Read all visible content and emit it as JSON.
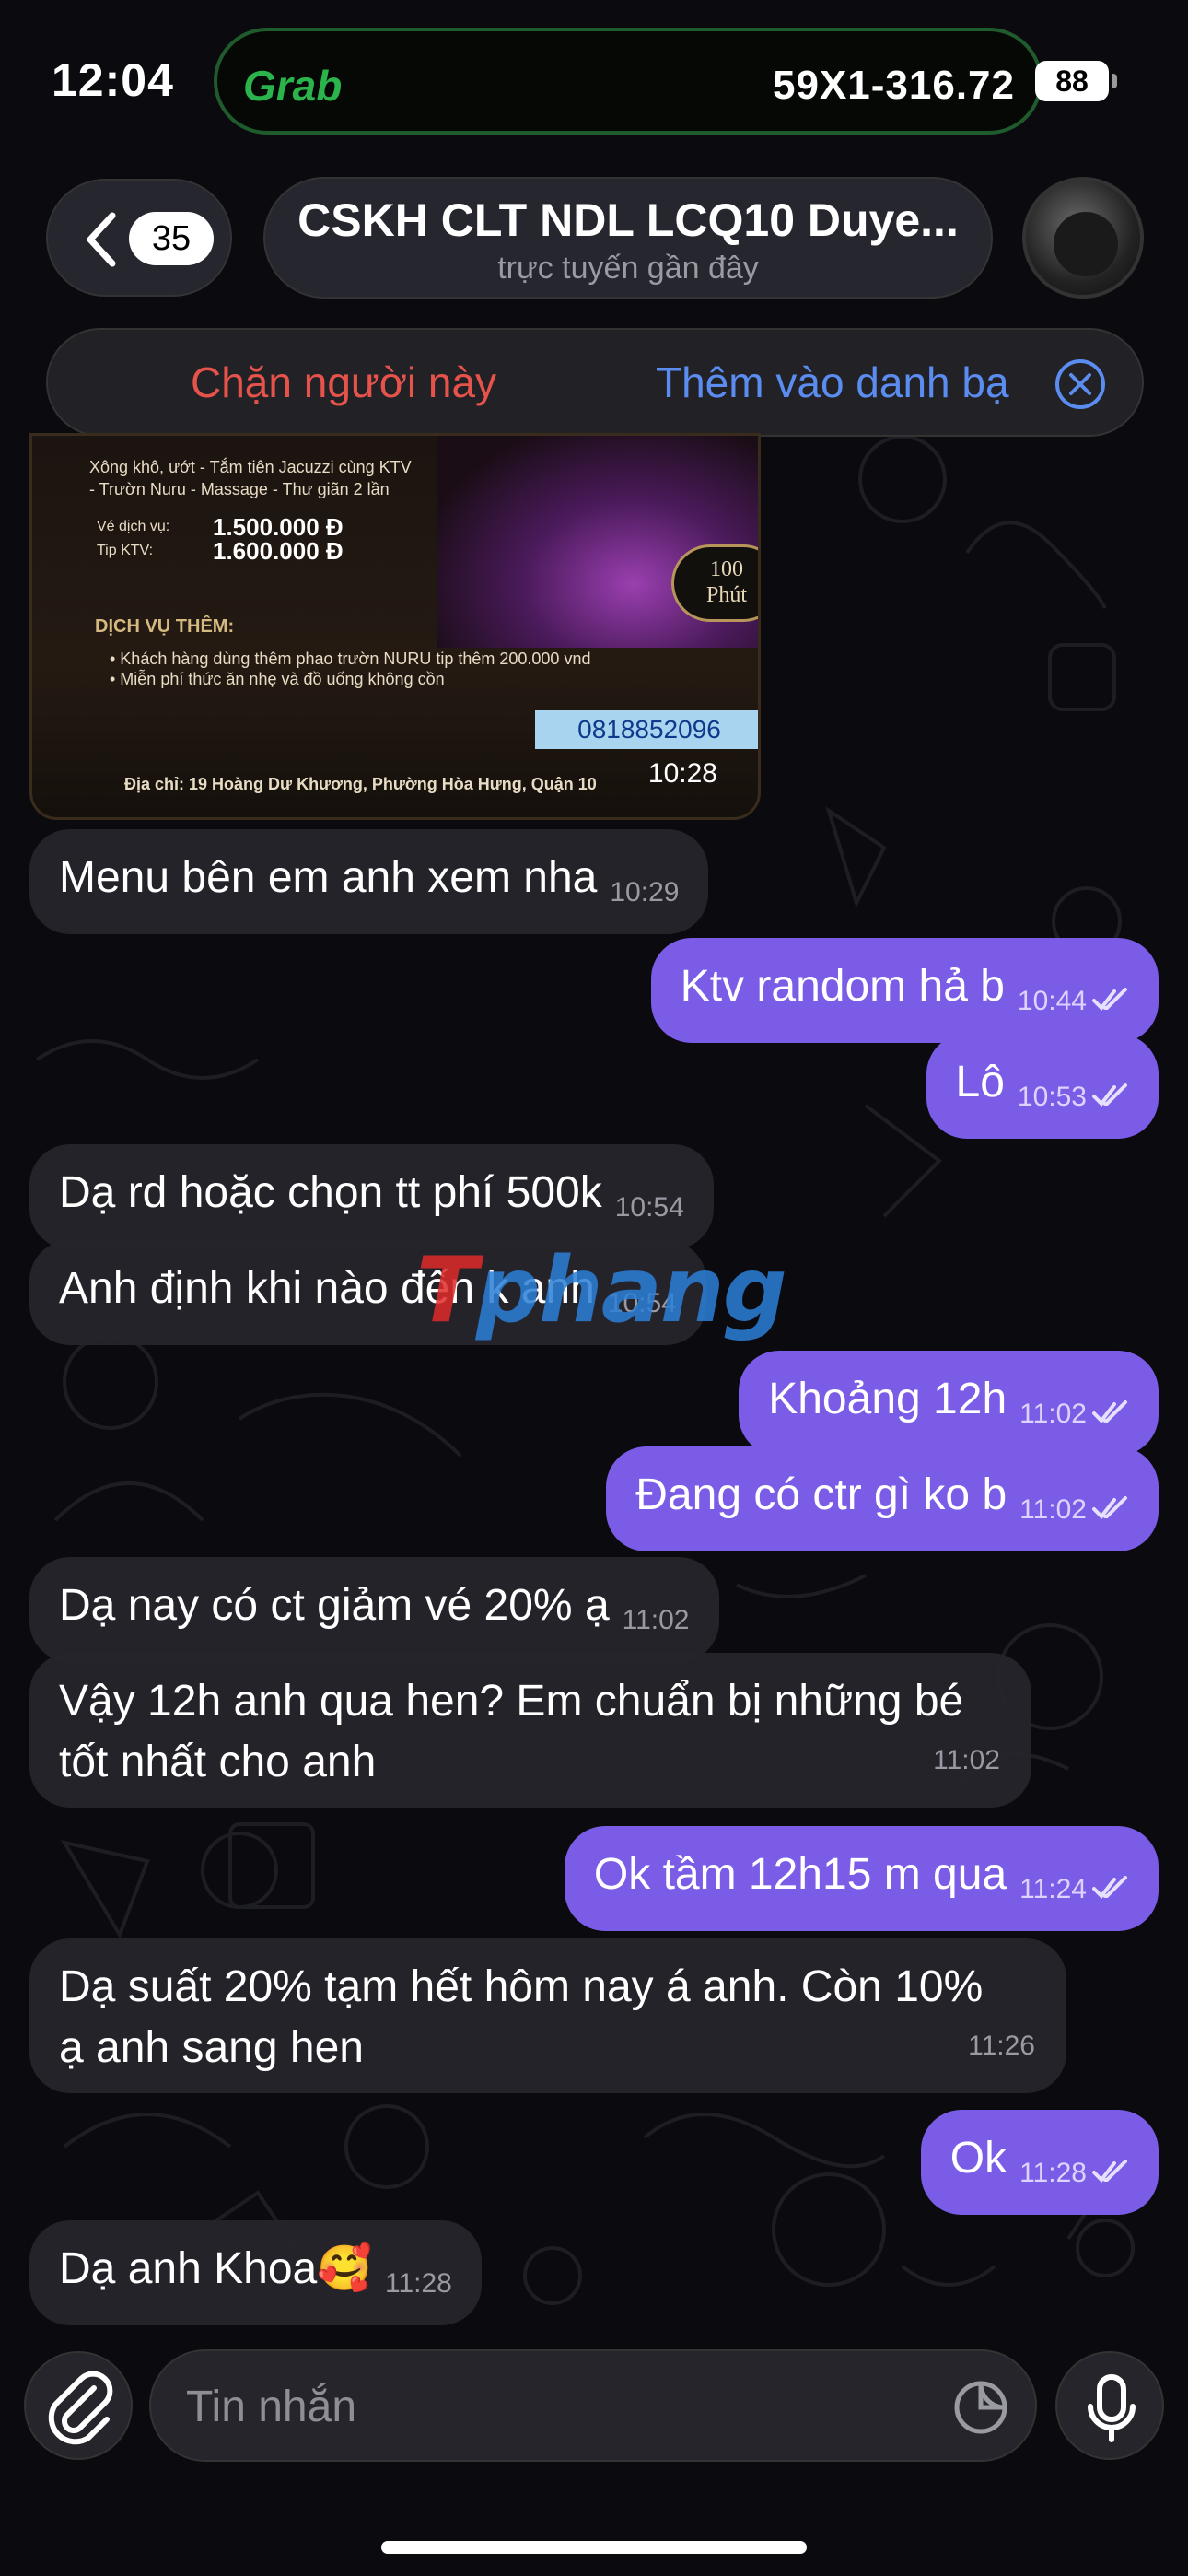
{
  "status_bar": {
    "time": "12:04",
    "app_name": "Grab",
    "plate": "59X1-316.72",
    "battery": "88"
  },
  "header": {
    "back_count": "35",
    "title": "CSKH CLT NDL LCQ10 Duye...",
    "subtitle": "trực tuyến gần đây"
  },
  "action_bar": {
    "block_label": "Chặn người này",
    "add_contact_label": "Thêm vào danh bạ"
  },
  "image_message": {
    "line1": "Xông khô, ướt - Tắm tiên Jacuzzi cùng KTV",
    "line2": "- Trườn Nuru - Massage - Thư giãn 2 lần",
    "service_label": "Vé dịch vụ:",
    "service_price": "1.500.000 Đ",
    "tip_label": "Tip KTV:",
    "tip_price": "1.600.000 Đ",
    "badge_num": "100",
    "badge_unit": "Phút",
    "extra_title": "DỊCH VỤ THÊM:",
    "extra_1": "•  Khách hàng dùng thêm phao trườn NURU tip thêm 200.000 vnd",
    "extra_2": "•  Miễn phí thức ăn nhẹ và đồ uống không cồn",
    "phone": "0818852096",
    "address": "Địa chỉ: 19 Hoàng Dư Khương, Phường Hòa Hưng, Quận 10",
    "time": "10:28"
  },
  "messages": [
    {
      "dir": "in",
      "text": "Menu bên em anh xem nha",
      "time": "10:29"
    },
    {
      "dir": "out",
      "text": "Ktv random hả b",
      "time": "10:44"
    },
    {
      "dir": "out",
      "text": "Lô",
      "time": "10:53"
    },
    {
      "dir": "in",
      "text": "Dạ rd hoặc chọn tt phí 500k",
      "time": "10:54"
    },
    {
      "dir": "in",
      "text": "Anh định khi nào đến k anh",
      "time": "10:54"
    },
    {
      "dir": "out",
      "text": "Khoảng 12h",
      "time": "11:02"
    },
    {
      "dir": "out",
      "text": "Đang có ctr gì ko b",
      "time": "11:02"
    },
    {
      "dir": "in",
      "text": "Dạ nay có ct giảm vé 20% ạ",
      "time": "11:02"
    },
    {
      "dir": "in",
      "line1": "Vậy 12h anh qua hen? Em chuẩn bị những bé",
      "line2": "tốt nhất cho anh",
      "time": "11:02"
    },
    {
      "dir": "out",
      "text": "Ok tầm 12h15 m qua",
      "time": "11:24"
    },
    {
      "dir": "in",
      "line1": "Dạ suất 20% tạm hết hôm nay á anh. Còn 10%",
      "line2": "ạ anh sang hen",
      "time": "11:26"
    },
    {
      "dir": "out",
      "text": "Ok",
      "time": "11:28"
    },
    {
      "dir": "in",
      "text": "Dạ anh Khoa🥰",
      "time": "11:28"
    }
  ],
  "watermark": {
    "part1": "T",
    "part2": "phang"
  },
  "composer": {
    "placeholder": "Tin nhắn"
  },
  "colors": {
    "outgoing": "#7b5ce6",
    "incoming": "#26242c",
    "block": "#e5534b",
    "link": "#5b8cf0"
  },
  "icons": [
    "back-chevron-icon",
    "close-icon",
    "paperclip-icon",
    "sticker-icon",
    "microphone-icon",
    "double-check-icon"
  ]
}
